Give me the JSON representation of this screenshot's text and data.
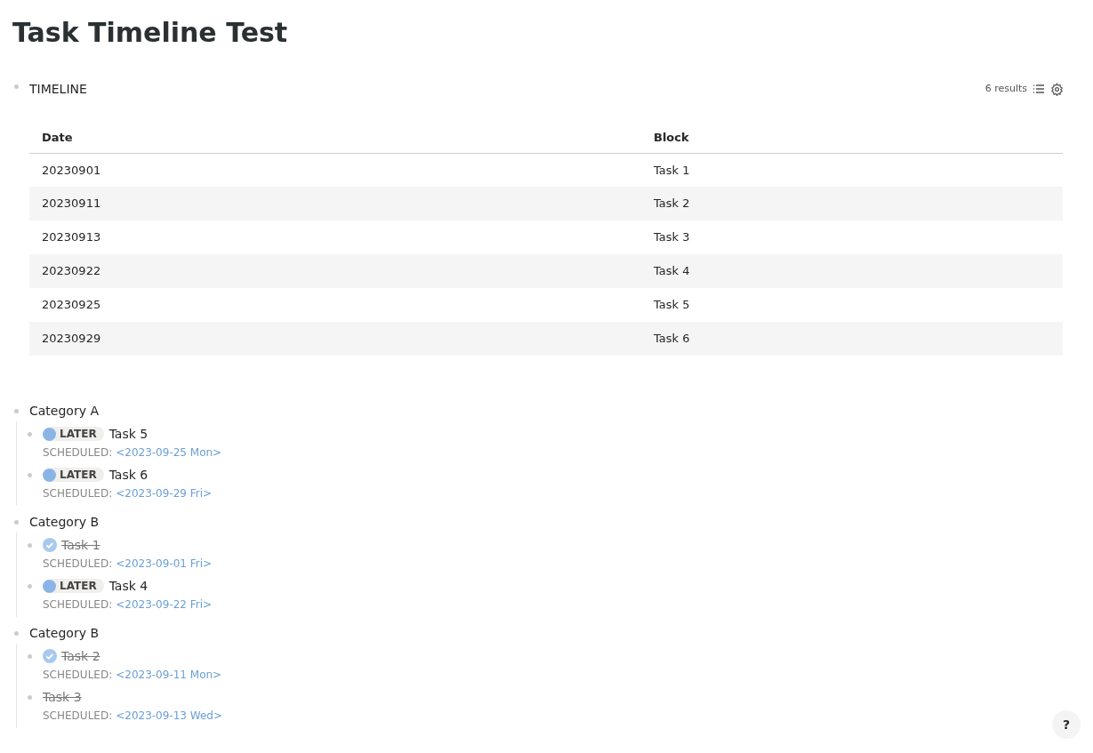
{
  "page_title": "Task Timeline Test",
  "query": {
    "title": "TIMELINE",
    "result_count": "6 results",
    "table": {
      "columns": [
        "Date",
        "Block"
      ],
      "rows": [
        {
          "date": "20230901",
          "block": "Task 1"
        },
        {
          "date": "20230911",
          "block": "Task 2"
        },
        {
          "date": "20230913",
          "block": "Task 3"
        },
        {
          "date": "20230922",
          "block": "Task 4"
        },
        {
          "date": "20230925",
          "block": "Task 5"
        },
        {
          "date": "20230929",
          "block": "Task 6"
        }
      ]
    }
  },
  "groups": [
    {
      "title": "Category A",
      "children": [
        {
          "kind": "later",
          "marker": "LATER",
          "title": "Task 5",
          "scheduled_label": "SCHEDULED:",
          "scheduled_date": "<2023-09-25 Mon>"
        },
        {
          "kind": "later",
          "marker": "LATER",
          "title": "Task 6",
          "scheduled_label": "SCHEDULED:",
          "scheduled_date": "<2023-09-29 Fri>"
        }
      ]
    },
    {
      "title": "Category B",
      "children": [
        {
          "kind": "done",
          "title": "Task 1",
          "scheduled_label": "SCHEDULED:",
          "scheduled_date": "<2023-09-01 Fri>"
        },
        {
          "kind": "later",
          "marker": "LATER",
          "title": "Task 4",
          "scheduled_label": "SCHEDULED:",
          "scheduled_date": "<2023-09-22 Fri>"
        }
      ]
    },
    {
      "title": "Category B",
      "children": [
        {
          "kind": "done",
          "title": "Task 2",
          "scheduled_label": "SCHEDULED:",
          "scheduled_date": "<2023-09-11 Mon>"
        },
        {
          "kind": "canceled",
          "title": "Task 3",
          "scheduled_label": "SCHEDULED:",
          "scheduled_date": "<2023-09-13 Wed>"
        }
      ]
    }
  ],
  "help_button": "?"
}
